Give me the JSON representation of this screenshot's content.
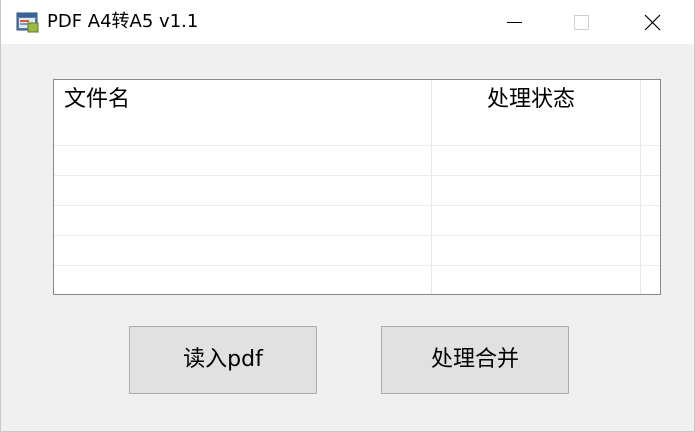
{
  "window": {
    "title": "PDF A4转A5 v1.1",
    "icon": "app-window-icon",
    "controls": [
      "minimize-icon",
      "maximize-icon",
      "close-icon"
    ]
  },
  "file_list": {
    "columns": [
      "文件名",
      "处理状态"
    ],
    "rows": []
  },
  "buttons": {
    "load_label": "读入pdf",
    "process_label": "处理合并"
  }
}
